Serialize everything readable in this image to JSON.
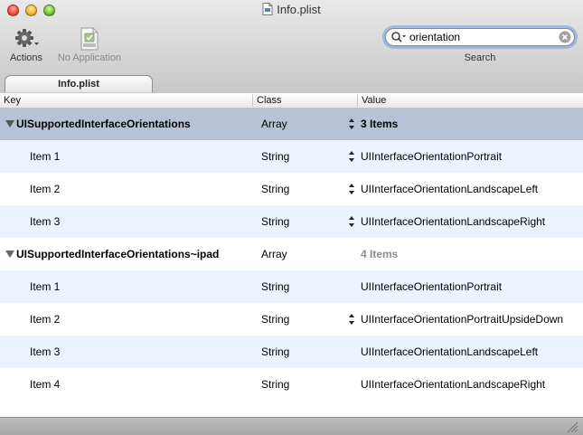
{
  "window": {
    "title": "Info.plist",
    "icon": "plist-document-icon"
  },
  "toolbar": {
    "actions_label": "Actions",
    "actions_icon": "gear-icon",
    "no_app_label": "No Application",
    "no_app_icon": "plist-file-icon",
    "search_label": "Search",
    "search_value": "orientation"
  },
  "tabs": [
    {
      "label": "Info.plist",
      "active": true
    }
  ],
  "columns": {
    "key": "Key",
    "class": "Class",
    "value": "Value"
  },
  "rows": [
    {
      "key": "UISupportedInterfaceOrientations",
      "class": "Array",
      "value": "3 Items",
      "level": 0,
      "expanded": true,
      "selected": true
    },
    {
      "key": "Item 1",
      "class": "String",
      "value": "UIInterfaceOrientationPortrait",
      "level": 1
    },
    {
      "key": "Item 2",
      "class": "String",
      "value": "UIInterfaceOrientationLandscapeLeft",
      "level": 1
    },
    {
      "key": "Item 3",
      "class": "String",
      "value": "UIInterfaceOrientationLandscapeRight",
      "level": 1
    },
    {
      "key": "UISupportedInterfaceOrientations~ipad",
      "class": "Array",
      "value": "4 Items",
      "level": 0,
      "expanded": true,
      "selected": false
    },
    {
      "key": "Item 1",
      "class": "String",
      "value": "UIInterfaceOrientationPortrait",
      "level": 1
    },
    {
      "key": "Item 2",
      "class": "String",
      "value": "UIInterfaceOrientationPortraitUpsideDown",
      "level": 1
    },
    {
      "key": "Item 3",
      "class": "String",
      "value": "UIInterfaceOrientationLandscapeLeft",
      "level": 1
    },
    {
      "key": "Item 4",
      "class": "String",
      "value": "UIInterfaceOrientationLandscapeRight",
      "level": 1
    }
  ],
  "colors": {
    "selected_row": "#b6c3d6",
    "alt_row": "#edf3fe",
    "focus_ring": "#7199dc"
  }
}
